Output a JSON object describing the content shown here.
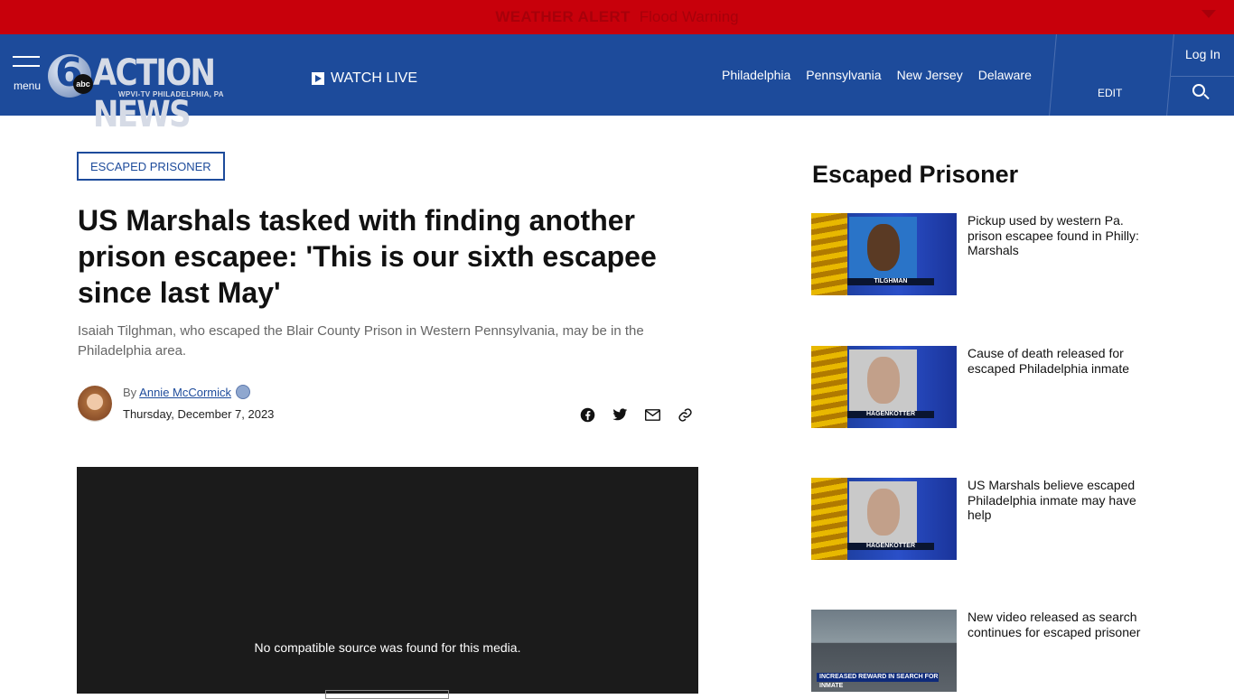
{
  "alert": {
    "label": "WEATHER ALERT",
    "text": "Flood Warning"
  },
  "nav": {
    "menu_label": "menu",
    "logo": {
      "six": "6",
      "abc": "abc",
      "name": "ACTION NEWS",
      "sub": "WPVI-TV  PHILADELPHIA, PA"
    },
    "watch_live": "WATCH LIVE",
    "links": [
      "Philadelphia",
      "Pennsylvania",
      "New Jersey",
      "Delaware"
    ],
    "edit": "EDIT",
    "login": "Log In"
  },
  "article": {
    "tag": "ESCAPED PRISONER",
    "headline": "US Marshals tasked with finding another prison escapee: 'This is our sixth escapee since last May'",
    "dek": "Isaiah Tilghman, who escaped the Blair County Prison in Western Pennsylvania, may be in the Philadelphia area.",
    "by": "By",
    "author": "Annie McCormick",
    "date": "Thursday, December 7, 2023",
    "share_icons": [
      "facebook-icon",
      "twitter-icon",
      "email-icon",
      "link-icon"
    ],
    "video_message": "No compatible source was found for this media."
  },
  "sidebar": {
    "heading": "Escaped Prisoner",
    "items": [
      {
        "title": "Pickup used by western Pa. prison escapee found in Philly: Marshals",
        "caption": "TILGHMAN"
      },
      {
        "title": "Cause of death released for escaped Philadelphia inmate",
        "caption": "HAGENKOTTER"
      },
      {
        "title": "US Marshals believe escaped Philadelphia inmate may have help",
        "caption": "HAGENKOTTER"
      },
      {
        "title": "New video released as search continues for escaped prisoner",
        "caption": "INCREASED REWARD IN SEARCH FOR INMATE"
      }
    ]
  },
  "colors": {
    "alert_red": "#c8000b",
    "nav_blue": "#1d4b9b",
    "link_blue": "#1d4b9b"
  }
}
